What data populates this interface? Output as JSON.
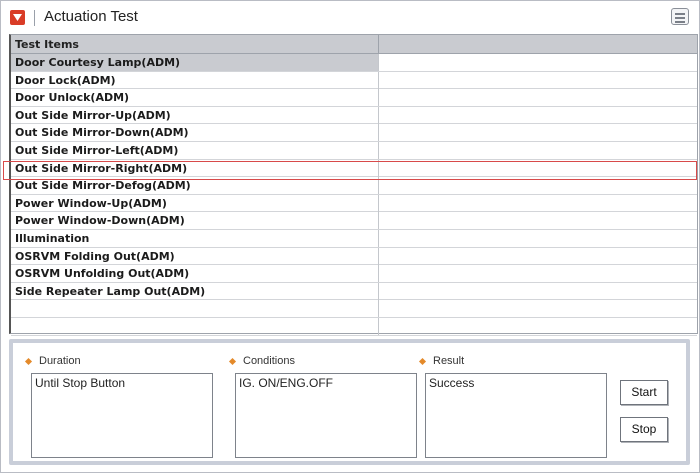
{
  "window": {
    "title": "Actuation Test"
  },
  "table": {
    "headers": [
      "Test Items",
      ""
    ],
    "rows": [
      {
        "item": "Door Courtesy Lamp(ADM)",
        "value": ""
      },
      {
        "item": "Door Lock(ADM)",
        "value": ""
      },
      {
        "item": "Door Unlock(ADM)",
        "value": ""
      },
      {
        "item": "Out Side Mirror-Up(ADM)",
        "value": ""
      },
      {
        "item": "Out Side Mirror-Down(ADM)",
        "value": ""
      },
      {
        "item": "Out Side Mirror-Left(ADM)",
        "value": ""
      },
      {
        "item": "Out Side Mirror-Right(ADM)",
        "value": ""
      },
      {
        "item": "Out Side Mirror-Defog(ADM)",
        "value": ""
      },
      {
        "item": "Power Window-Up(ADM)",
        "value": ""
      },
      {
        "item": "Power Window-Down(ADM)",
        "value": ""
      },
      {
        "item": "Illumination",
        "value": ""
      },
      {
        "item": "OSRVM Folding Out(ADM)",
        "value": ""
      },
      {
        "item": "OSRVM Unfolding Out(ADM)",
        "value": ""
      },
      {
        "item": "Side Repeater Lamp Out(ADM)",
        "value": ""
      },
      {
        "item": "",
        "value": ""
      },
      {
        "item": "",
        "value": ""
      }
    ]
  },
  "panel": {
    "duration_label": "Duration",
    "duration_value": "Until Stop Button",
    "conditions_label": "Conditions",
    "conditions_value": "IG. ON/ENG.OFF",
    "result_label": "Result",
    "result_value": "Success",
    "start_label": "Start",
    "stop_label": "Stop"
  },
  "icons": {
    "title": "collapse-arrow-icon",
    "menu": "list-menu-icon"
  },
  "colors": {
    "title_icon": "#d93c27",
    "highlight_border": "#d84a4a",
    "header_bg": "#c9cbd0",
    "bullet": "#e48a2a"
  }
}
